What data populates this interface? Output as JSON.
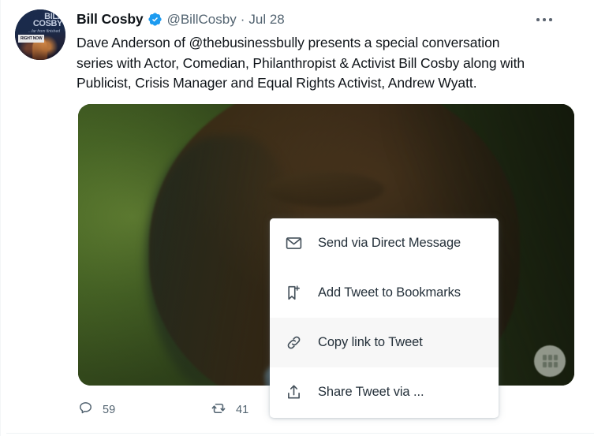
{
  "tweet": {
    "author": {
      "display_name": "Bill Cosby",
      "handle": "@BillCosby",
      "verified_icon": "verified-badge-icon",
      "avatar": {
        "title": "BILL COSBY",
        "subtitle": "...far from finished",
        "badge": "RIGHT NOW"
      }
    },
    "separator": "·",
    "date": "Jul 28",
    "body": "Dave Anderson of @thebusinessbully presents a special conversation series with Actor, Comedian, Philanthropist & Activist Bill Cosby along with Publicist, Crisis Manager and Equal Rights Activist, Andrew Wyatt.",
    "more_button_icon": "ellipsis-icon",
    "media": {
      "badge_icon": "media-settings-icon"
    },
    "actions": [
      {
        "icon": "reply-icon",
        "label": "Reply",
        "count": "59"
      },
      {
        "icon": "retweet-icon",
        "label": "Retweet",
        "count": "41"
      }
    ]
  },
  "share_menu": {
    "items": [
      {
        "icon": "envelope-icon",
        "label": "Send via Direct Message",
        "hovered": false
      },
      {
        "icon": "bookmark-plus-icon",
        "label": "Add Tweet to Bookmarks",
        "hovered": false
      },
      {
        "icon": "link-icon",
        "label": "Copy link to Tweet",
        "hovered": true
      },
      {
        "icon": "share-upload-icon",
        "label": "Share Tweet via ...",
        "hovered": false
      }
    ]
  },
  "colors": {
    "verified_blue": "#1d9bf0",
    "text_primary": "#0f1419",
    "text_secondary": "#536471",
    "menu_hover": "#f7f7f7",
    "border": "#eff3f4"
  }
}
